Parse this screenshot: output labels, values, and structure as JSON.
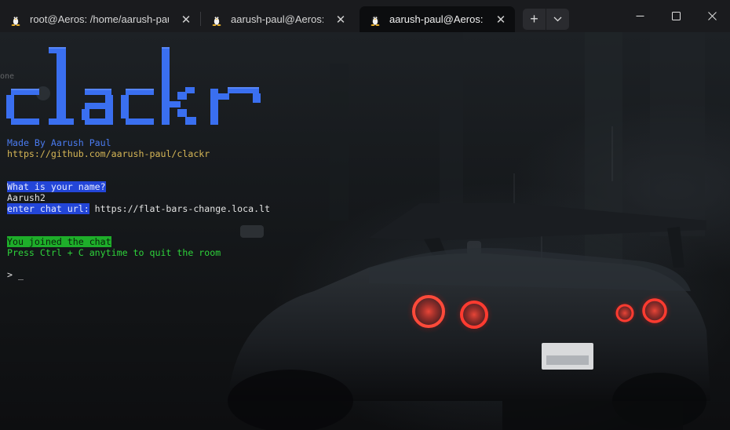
{
  "tabs": [
    {
      "title": "root@Aeros: /home/aarush-paul",
      "active": false
    },
    {
      "title": "aarush-paul@Aeros: ~",
      "active": false
    },
    {
      "title": "aarush-paul@Aeros: ~",
      "active": true
    }
  ],
  "tab_icon": "tux-linux-icon",
  "tab_close_glyph": "✕",
  "new_tab_glyph": "+",
  "dropdown_glyph": "⌄",
  "window_controls": {
    "minimize": "minimize-icon",
    "maximize": "maximize-icon",
    "close": "close-icon"
  },
  "terminal": {
    "banner": "clackr",
    "banner_color": "#3a6ff0",
    "made_by": "Made By Aarush Paul",
    "repo_url": "https://github.com/aarush-paul/clackr",
    "name_prompt": "What is your name?",
    "name_value": "Aarush2",
    "url_prompt": "enter chat url:",
    "url_value": " https://flat-bars-change.loca.lt",
    "joined": "You joined the chat",
    "quit_hint": "Press Ctrl + C anytime to quit the room",
    "prompt": "> ",
    "cursor": "_",
    "partial_text": "one"
  },
  "colors": {
    "accent_blue": "#2346d8",
    "accent_green": "#1eae2a",
    "text_yellow": "#d6b656",
    "text_blue": "#4a7bf0"
  }
}
